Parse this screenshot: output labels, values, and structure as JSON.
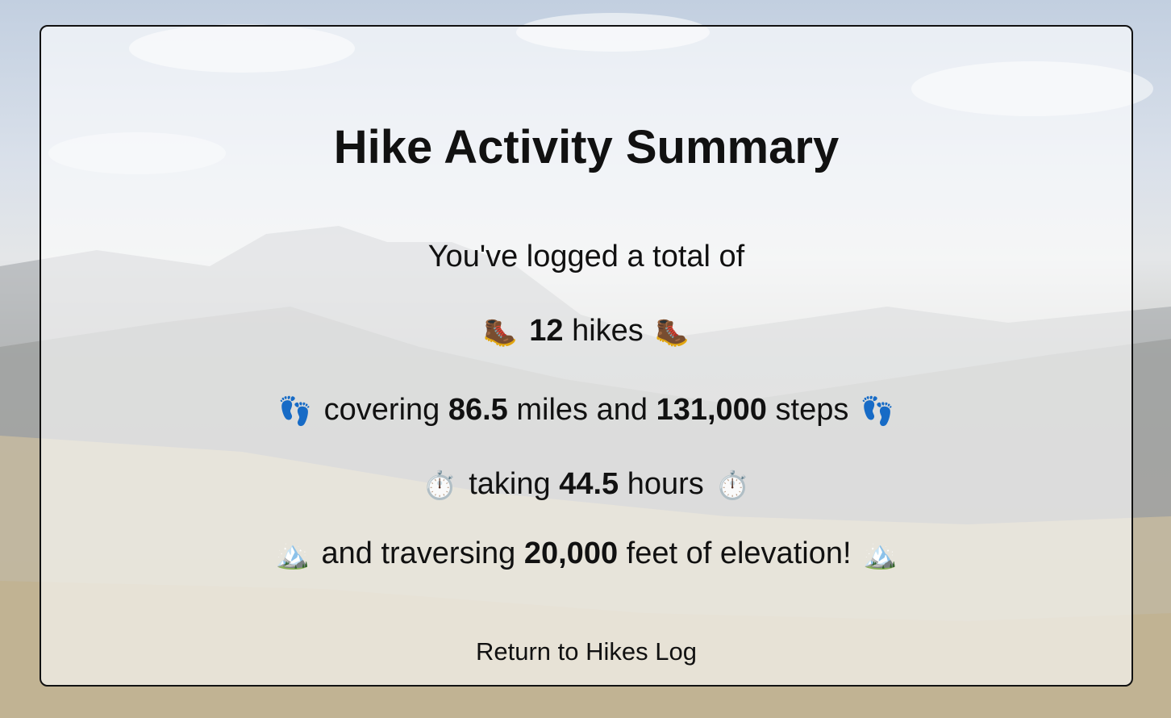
{
  "summary": {
    "title": "Hike Activity Summary",
    "intro": "You've logged a total of",
    "hikes": {
      "icon": "hiking-boot-icon",
      "icon_glyph": "🥾",
      "count": "12",
      "label": "hikes"
    },
    "distance": {
      "icon": "footprints-icon",
      "icon_glyph": "👣",
      "prefix": "covering",
      "miles": "86.5",
      "miles_label": "miles and",
      "steps": "131,000",
      "steps_label": "steps"
    },
    "time": {
      "icon": "stopwatch-icon",
      "icon_glyph": "⏱️",
      "prefix": "taking",
      "hours": "44.5",
      "hours_label": "hours"
    },
    "elevation": {
      "icon": "snow-capped-mountain-icon",
      "icon_glyph": "🏔️",
      "prefix": "and traversing",
      "feet": "20,000",
      "feet_label": "feet of elevation!"
    },
    "return_link": "Return to Hikes Log"
  }
}
